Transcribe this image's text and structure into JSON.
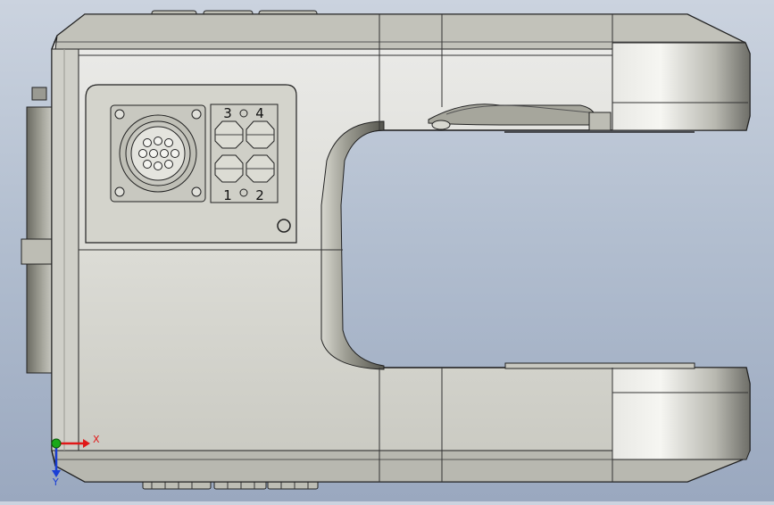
{
  "viewport": {
    "background_top": "#cbd3df",
    "background_bottom": "#9aa8bf",
    "body_color": "#dcdcd6",
    "edge_color": "#1a1a1a"
  },
  "connector_panel": {
    "pin_labels": {
      "top_left": "3",
      "top_right": "4",
      "bottom_left": "1",
      "bottom_right": "2"
    },
    "round_connector_pin_count": 10
  },
  "triad": {
    "x_label": "X",
    "y_label": "Y",
    "x_color": "#e01818",
    "y_color": "#1a3fd6",
    "origin_color": "#1aa81a"
  }
}
